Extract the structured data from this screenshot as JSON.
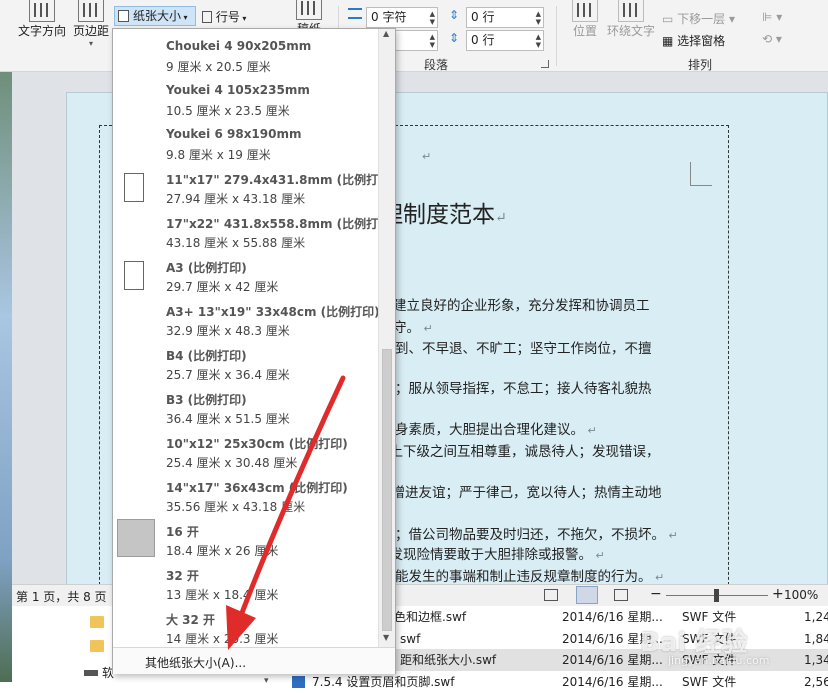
{
  "ribbon": {
    "text_direction": "文字方向",
    "margins": "页边距",
    "paper_size": "纸张大小",
    "line_numbers": "行号",
    "manuscript": "稿纸",
    "indent_left": "0 字符",
    "indent_right": "符",
    "spacing_before": "0 行",
    "spacing_after": "0 行",
    "paragraph_group": "段落",
    "position": "位置",
    "wrap_text": "环绕文字",
    "send_backward": "下移一层",
    "selection_pane": "选择窗格",
    "arrange_group": "排列"
  },
  "paper_menu": {
    "items": [
      {
        "name": "Choukei 4 90x205mm",
        "dims": "9 厘米 x 20.5 厘米",
        "icon": "none"
      },
      {
        "name": "Youkei 4 105x235mm",
        "dims": "10.5 厘米 x 23.5 厘米",
        "icon": "none"
      },
      {
        "name": "Youkei 6 98x190mm",
        "dims": "9.8 厘米 x 19 厘米",
        "icon": "none"
      },
      {
        "name": "11\"x17\" 279.4x431.8mm (比例打印)",
        "dims": "27.94 厘米 x 43.18 厘米",
        "icon": "page"
      },
      {
        "name": "17\"x22\" 431.8x558.8mm (比例打印)",
        "dims": "43.18 厘米 x 55.88 厘米",
        "icon": "none"
      },
      {
        "name": "A3 (比例打印)",
        "dims": "29.7 厘米 x 42 厘米",
        "icon": "page"
      },
      {
        "name": "A3+ 13\"x19\" 33x48cm (比例打印)",
        "dims": "32.9 厘米 x 48.3 厘米",
        "icon": "none"
      },
      {
        "name": "B4 (比例打印)",
        "dims": "25.7 厘米 x 36.4 厘米",
        "icon": "none"
      },
      {
        "name": "B3 (比例打印)",
        "dims": "36.4 厘米 x 51.5 厘米",
        "icon": "none"
      },
      {
        "name": "10\"x12\" 25x30cm (比例打印)",
        "dims": "25.4 厘米 x 30.48 厘米",
        "icon": "none"
      },
      {
        "name": "14\"x17\" 36x43cm (比例打印)",
        "dims": "35.56 厘米 x 43.18 厘米",
        "icon": "none"
      },
      {
        "name": "16 开",
        "dims": "18.4 厘米 x 26 厘米",
        "icon": "selected"
      },
      {
        "name": "32 开",
        "dims": "13 厘米 x 18.4 厘米",
        "icon": "none"
      },
      {
        "name": "大 32 开",
        "dims": "14 厘米 x 20.3 厘米",
        "icon": "none"
      }
    ],
    "more_sizes": "其他纸张大小(A)..."
  },
  "document": {
    "title": "理制度范本",
    "lines": [
      "德，建立良好的企业形象，充分发挥和协调员工",
      "须遵守。",
      "不迟到、不早退、不旷工；坚守工作岗位，不擅",
      "条款；服从领导指挥，不怠工；接人待客礼貌热",
      "高自身素质，大胆提出合理化建议。",
      "，上下级之间互相尊重，诚恳待人；发现错误，",
      "，增进友谊；严于律己，宽以待人；热情主动地",
      "浪费；借公司物品要及时归还，不拖欠，不损坏。",
      "；发现险情要敢于大胆排除或报警。",
      "除可能发生的事端和制止违反规章制度的行为。"
    ]
  },
  "statusbar": {
    "page_info": "第 1 页，共 8 页",
    "zoom": "100%"
  },
  "explorer": {
    "rows": [
      {
        "name": "颜色和边框.swf",
        "date": "2014/6/16 星期...",
        "type": "SWF 文件",
        "size": "1,24"
      },
      {
        "name": "swf",
        "date": "2014/6/16 星期...",
        "type": "SWF 文件",
        "size": "1,84"
      },
      {
        "name": "距和纸张大小.swf",
        "date": "2014/6/16 星期...",
        "type": "SWF 文件",
        "size": "1,34"
      },
      {
        "name": "7.5.4  设置页眉和页脚.swf",
        "date": "2014/6/16 星期...",
        "type": "SWF 文件",
        "size": "2,56"
      }
    ],
    "drive_label": "软"
  },
  "watermark": {
    "text": "Bai 经验",
    "url": "jingyan.baidu.com"
  }
}
